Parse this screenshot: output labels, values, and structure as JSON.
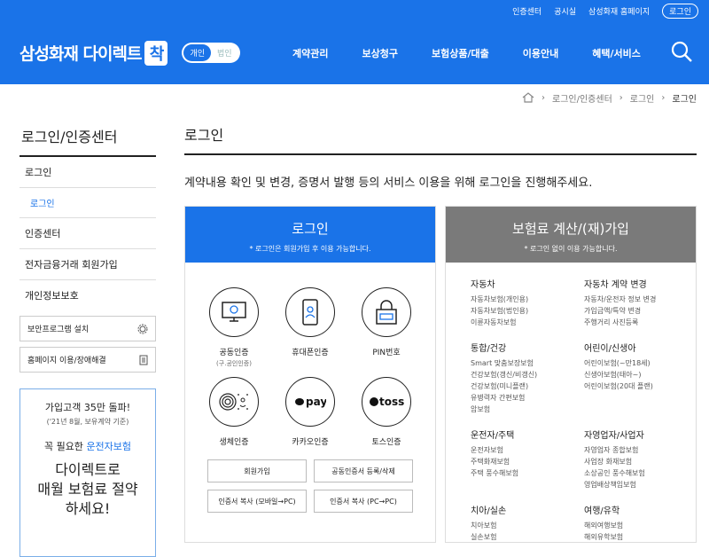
{
  "util_links": [
    "인증센터",
    "공시실",
    "삼성화재 홈페이지"
  ],
  "util_login": "로그인",
  "logo": {
    "text": "삼성화재 다이렉트",
    "badge": "착"
  },
  "toggle": [
    "개인",
    "법인"
  ],
  "menu": [
    "계약관리",
    "보상청구",
    "보험상품/대출",
    "이용안내",
    "혜택/서비스"
  ],
  "breadcrumb": [
    "로그인/인증센터",
    "로그인",
    "로그인"
  ],
  "side": {
    "title": "로그인/인증센터",
    "items": [
      "로그인",
      "로그인",
      "인증센터",
      "전자금융거래 회원가입",
      "개인정보보호"
    ],
    "boxes": [
      "보안프로그램 설치",
      "홈페이지 이용/장애해결"
    ],
    "ad": {
      "l1": "가입고객 35만 돌파!",
      "l2": "('21년 8월, 보유계약 기준)",
      "l3a": "꼭 필요한 ",
      "l3b": "운전자보험",
      "l4": "다이렉트로",
      "l5": "매월 보험료 절약",
      "l6": "하세요!"
    }
  },
  "main": {
    "title": "로그인",
    "desc": "계약내용 확인 및 변경, 증명서 발행 등의 서비스 이용을 위해 로그인을 진행해주세요.",
    "login": {
      "title": "로그인",
      "note": "* 로그인은 회원가입 후 이용 가능합니다.",
      "methods": [
        {
          "label": "공동인증",
          "sub": "(구.공인인증)"
        },
        {
          "label": "휴대폰인증",
          "sub": ""
        },
        {
          "label": "PIN번호",
          "sub": ""
        },
        {
          "label": "생체인증",
          "sub": ""
        },
        {
          "label": "카카오인증",
          "sub": ""
        },
        {
          "label": "토스인증",
          "sub": ""
        }
      ],
      "pay_text": "pay",
      "toss_text": "toss",
      "buttons": [
        "회원가입",
        "공동인증서 등록/삭제",
        "인증서 복사 (모바일→PC)",
        "인증서 복사 (PC→PC)"
      ]
    },
    "calc": {
      "title": "보험료 계산/(재)가입",
      "note": "* 로그인 없이 이용 가능합니다.",
      "groups": [
        {
          "title": "자동차",
          "items": [
            "자동차보험(개인용)",
            "자동차보험(법인용)",
            "이륜자동차보험"
          ]
        },
        {
          "title": "자동차 계약 변경",
          "items": [
            "자동차/운전자 정보 변경",
            "가입금액/특약 변경",
            "주행거리 사진등록"
          ]
        },
        {
          "title": "통합/건강",
          "items": [
            "Smart 맞춤보장보험",
            "건강보험(갱신/비갱신)",
            "건강보험(미니플랜)",
            "유병력자 간편보험",
            "암보험"
          ]
        },
        {
          "title": "어린이/신생아",
          "items": [
            "어린이보험(~만18세)",
            "신생아보험(태아~)",
            "어린이보험(20대 플랜)"
          ]
        },
        {
          "title": "운전자/주택",
          "items": [
            "운전자보험",
            "주택화재보험",
            "주택 풍수해보험"
          ]
        },
        {
          "title": "자영업자/사업자",
          "items": [
            "자영업자 종합보험",
            "사업장 화재보험",
            "소상공인 풍수해보험",
            "영업배상책임보험"
          ]
        },
        {
          "title": "치아/실손",
          "items": [
            "치아보험",
            "실손보험"
          ]
        },
        {
          "title": "여행/유학",
          "items": [
            "해외여행보험",
            "해외유학보험"
          ]
        }
      ]
    }
  }
}
